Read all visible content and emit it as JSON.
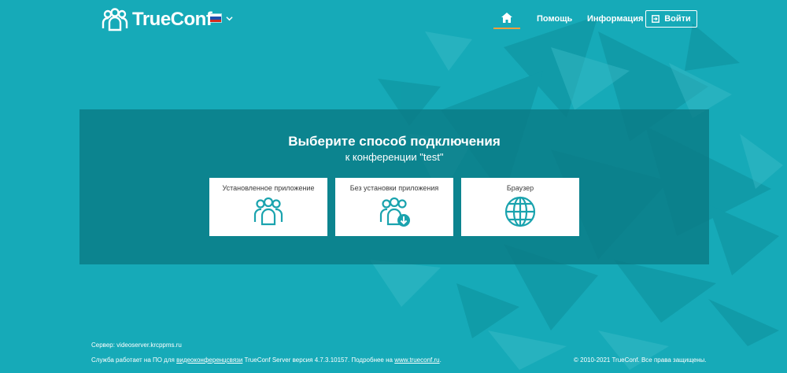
{
  "header": {
    "logo_text": "TrueConf",
    "language_flag": {
      "colors": [
        "#ffffff",
        "#1f4fae",
        "#d52b1e"
      ]
    },
    "nav": {
      "home_icon": "home-icon",
      "help": "Помощь",
      "info": "Информация",
      "login": "Войти"
    },
    "accent_color": "#f2a03d"
  },
  "main": {
    "title": "Выберите способ подключения",
    "subtitle": "к конференции \"test\"",
    "options": [
      {
        "label": "Установленное приложение",
        "icon": "users-group-icon"
      },
      {
        "label": "Без установки приложения",
        "icon": "users-download-icon"
      },
      {
        "label": "Браузер",
        "icon": "globe-icon"
      }
    ]
  },
  "footer": {
    "server": "Сервер: videoserver.krcppms.ru",
    "service_prefix": "Служба работает на ПО для",
    "service_link1": "видеоконференцсвязи",
    "service_middle": "TrueConf Server версия 4.7.3.10157. Подробнее на",
    "service_link2": "www.trueconf.ru",
    "service_suffix": ".",
    "copyright": "© 2010-2021 TrueConf. Все права защищены."
  },
  "colors": {
    "background": "#16aab8",
    "panel": "#0a7a84",
    "icon_teal": "#1aa3ae"
  }
}
